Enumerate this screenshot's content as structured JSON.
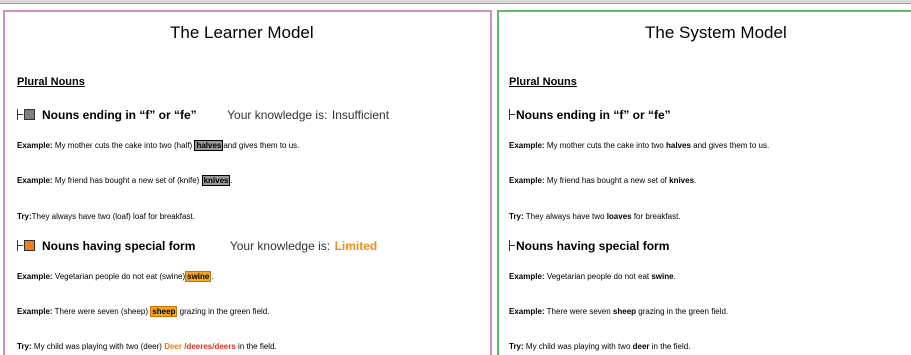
{
  "learner": {
    "title": "The Learner Model",
    "section": "Plural Nouns",
    "topic1": {
      "label": "Nouns ending in “f” or “fe”",
      "knowledge_prefix": "Your knowledge is:",
      "knowledge_value": "Insufficient",
      "status_color": "#7f7f7f"
    },
    "ex1": {
      "lead": "Example:",
      "before": "My mother cuts the cake into two (half)",
      "answer": "halves",
      "after": "and gives them to us."
    },
    "ex2": {
      "lead": "Example:",
      "before": "My friend has bought a new set of (knife)",
      "answer": "knives",
      "after": "."
    },
    "try1": {
      "lead": "Try:",
      "text": "They always have two (loaf) loaf for breakfast."
    },
    "topic2": {
      "label": "Nouns having special form",
      "knowledge_prefix": "Your knowledge is:",
      "knowledge_value": "Limited",
      "status_color": "#f07d1a"
    },
    "ex3": {
      "lead": "Example:",
      "before": "Vegetarian people do not eat (swine)",
      "answer": "swine",
      "after": "."
    },
    "ex4": {
      "lead": "Example:",
      "before": "There were seven (sheep)",
      "answer": "sheep",
      "after": "grazing in the green field."
    },
    "try2": {
      "lead": "Try:",
      "before": "My child was playing with two (deer)",
      "answer_orange": "Deer",
      "answer_red": "/deeres/deers",
      "after": "in the field."
    }
  },
  "system": {
    "title": "The System Model",
    "section": "Plural Nouns",
    "topic1": "Nouns ending in “f” or “fe”",
    "ex1": {
      "lead": "Example:",
      "before": "My mother cuts the cake into two",
      "answer": "halves",
      "after": "and gives them to us."
    },
    "ex2": {
      "lead": "Example:",
      "before": "My friend has bought a new set of",
      "answer": "knives",
      "after": "."
    },
    "try1": {
      "lead": "Try:",
      "before": "They always have two",
      "answer": "loaves",
      "after": "for breakfast."
    },
    "topic2": "Nouns having special form",
    "ex3": {
      "lead": "Example:",
      "before": "Vegetarian people do not eat",
      "answer": "swine",
      "after": "."
    },
    "ex4": {
      "lead": "Example:",
      "before": "There were seven",
      "answer": "sheep",
      "after": "grazing in the green field."
    },
    "try2": {
      "lead": "Try:",
      "before": "My child was playing with two",
      "answer": "deer",
      "after": "in the field."
    }
  }
}
